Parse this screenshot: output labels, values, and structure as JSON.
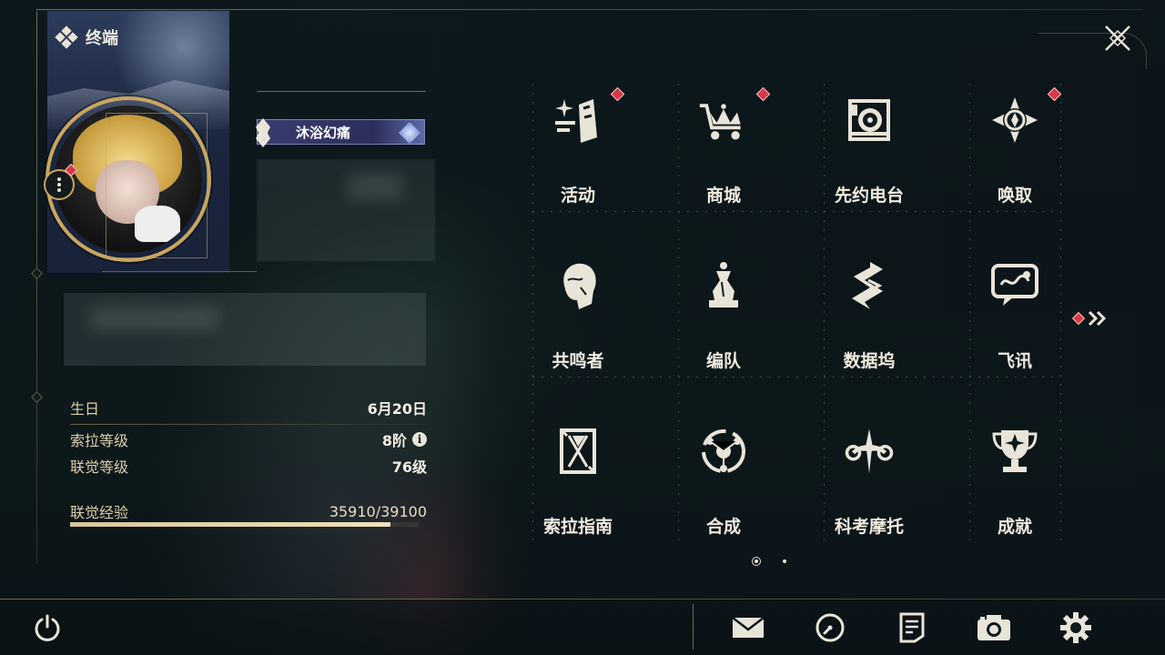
{
  "header": {
    "title": "终端"
  },
  "profile": {
    "title_badge": "沐浴幻痛",
    "stats": [
      {
        "label": "生日",
        "value": "6月20日"
      },
      {
        "label": "索拉等级",
        "value": "8阶"
      },
      {
        "label": "联觉等级",
        "value": "76级"
      }
    ],
    "exp": {
      "label": "联觉经验",
      "value": "35910/39100",
      "current": 35910,
      "max": 39100,
      "fraction": 0.918
    }
  },
  "menu": {
    "items": [
      {
        "label": "活动",
        "icon": "activity-icon",
        "badge": true
      },
      {
        "label": "商城",
        "icon": "shop-cart-icon",
        "badge": true
      },
      {
        "label": "先约电台",
        "icon": "radio-icon",
        "badge": false
      },
      {
        "label": "唤取",
        "icon": "convene-icon",
        "badge": true
      },
      {
        "label": "共鸣者",
        "icon": "resonator-icon",
        "badge": false
      },
      {
        "label": "编队",
        "icon": "team-icon",
        "badge": false
      },
      {
        "label": "数据坞",
        "icon": "databank-icon",
        "badge": false
      },
      {
        "label": "飞讯",
        "icon": "message-icon",
        "badge": false
      },
      {
        "label": "索拉指南",
        "icon": "guidebook-icon",
        "badge": false
      },
      {
        "label": "合成",
        "icon": "synthesis-icon",
        "badge": false
      },
      {
        "label": "科考摩托",
        "icon": "motorbike-icon",
        "badge": false
      },
      {
        "label": "成就",
        "icon": "trophy-icon",
        "badge": false
      }
    ],
    "page": {
      "current": 1,
      "total": 2
    }
  },
  "bottom_bar": {
    "buttons": [
      "power-icon",
      "mail-icon",
      "clock-icon",
      "notice-icon",
      "camera-icon",
      "settings-icon"
    ]
  },
  "colors": {
    "accent_gold": "#c9a560",
    "badge_red": "#d63848",
    "text": "#e9e4d8"
  }
}
